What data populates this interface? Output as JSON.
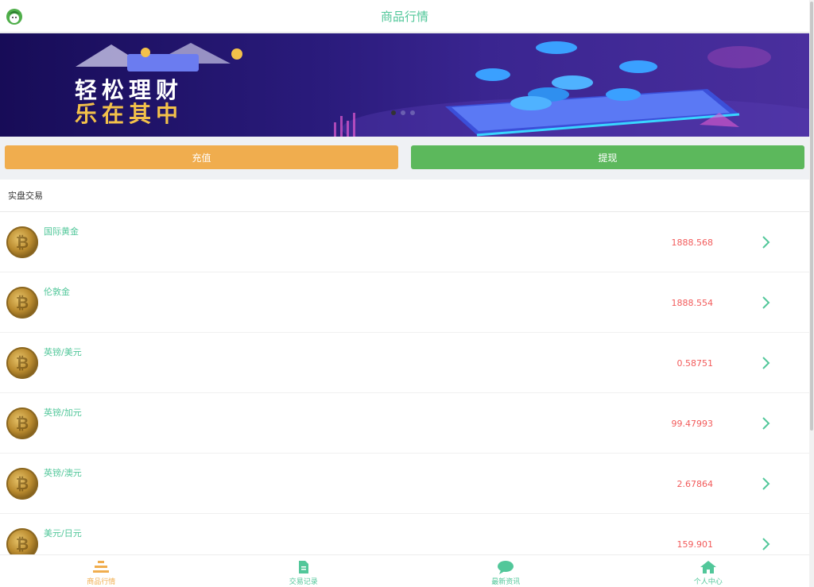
{
  "header": {
    "title": "商品行情",
    "logo_icon": "avatar-logo-icon"
  },
  "banner": {
    "slogan_line1": "轻松理财",
    "slogan_line2": "乐在其中"
  },
  "actions": {
    "recharge_label": "充值",
    "withdraw_label": "提现"
  },
  "section": {
    "title": "实盘交易"
  },
  "products": [
    {
      "name": "国际黄金",
      "price": "1888.568"
    },
    {
      "name": "伦敦金",
      "price": "1888.554"
    },
    {
      "name": "英镑/美元",
      "price": "0.58751"
    },
    {
      "name": "英镑/加元",
      "price": "99.47993"
    },
    {
      "name": "英镑/澳元",
      "price": "2.67864"
    },
    {
      "name": "美元/日元",
      "price": "159.901"
    }
  ],
  "tabs": [
    {
      "label": "商品行情",
      "icon": "market-icon",
      "active": true
    },
    {
      "label": "交易记录",
      "icon": "document-icon",
      "active": false
    },
    {
      "label": "最新资讯",
      "icon": "chat-bubble-icon",
      "active": false
    },
    {
      "label": "个人中心",
      "icon": "home-icon",
      "active": false
    }
  ],
  "colors": {
    "accent_green": "#52c79a",
    "recharge_orange": "#f0ad4e",
    "withdraw_green": "#5cb85c",
    "price_red": "#f25b5b"
  }
}
